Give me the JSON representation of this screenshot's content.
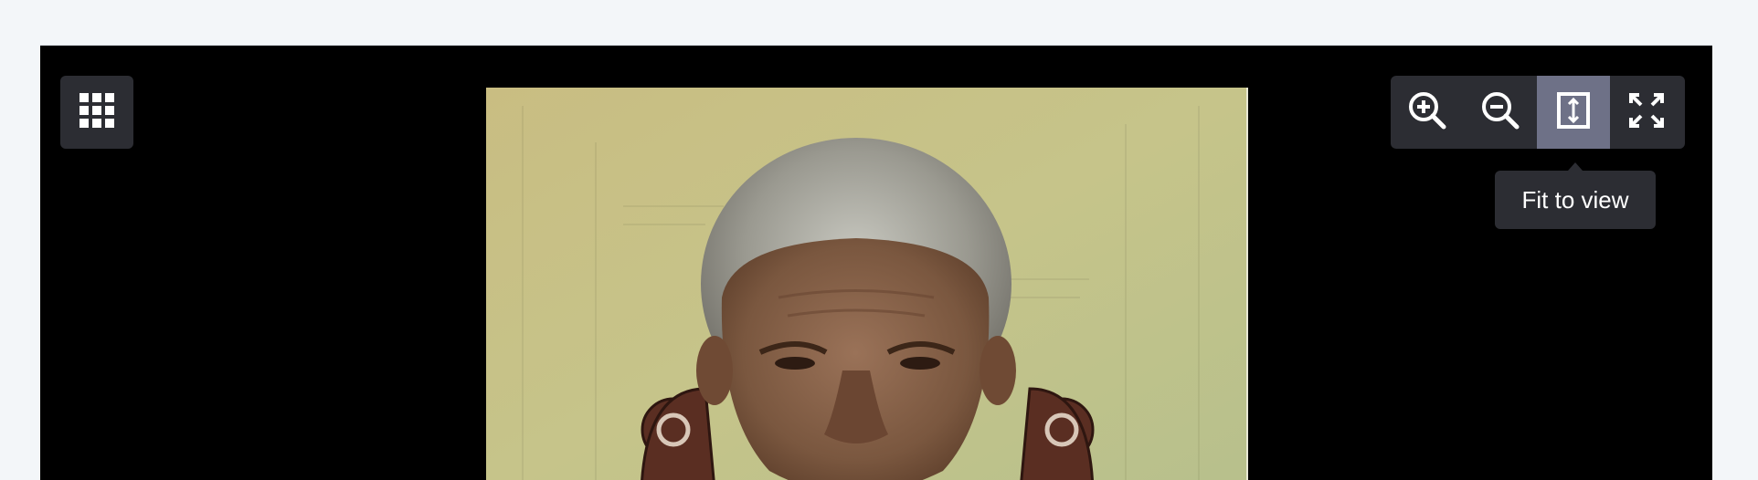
{
  "viewer": {
    "background": "#000000",
    "gallery_button": {
      "icon": "grid-icon"
    },
    "toolbar": {
      "tools": [
        {
          "name": "zoom-in",
          "icon": "zoom-in-icon"
        },
        {
          "name": "zoom-out",
          "icon": "zoom-out-icon"
        },
        {
          "name": "fit-to-view",
          "icon": "fit-to-view-icon",
          "active": true
        },
        {
          "name": "fullscreen",
          "icon": "fullscreen-icon"
        }
      ],
      "active_color": "#6e7187",
      "bar_color": "#2c2d33"
    },
    "tooltip": {
      "text": "Fit to view"
    },
    "image": {
      "kind": "portrait photograph"
    }
  }
}
